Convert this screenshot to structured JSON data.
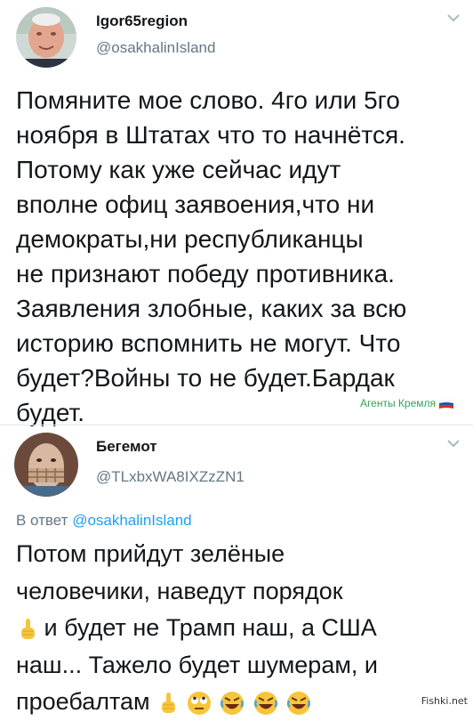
{
  "tweet1": {
    "name": "Igor65region",
    "handle": "@osakhalinIsland",
    "text": "Помяните мое слово. 4го или 5го\nноября в Штатах что то начнётся.\nПотому как уже сейчас идут\nвполне офиц заявоения,что ни\nдемократы,ни республиканцы\nне признают победу противника.\nЗаявления злобные, каких за всю\nисторию вспомнить не могут. Что\nбудет?Войны то не будет.Бардак\nбудет.",
    "badge": "Агенты Кремля"
  },
  "tweet2": {
    "name": "Бегемот",
    "handle": "@TLxbxWA8IXZzZN1",
    "reply_prefix": "В ответ",
    "reply_to": "@osakhalinIsland",
    "line1": "Потом прийдут зелёные",
    "line2": "человечики, наведут порядок",
    "line3": "и будет не Трамп наш, а США",
    "line4": "наш... Тажело будет шумерам, и",
    "line5": "проебалтам"
  },
  "watermark": "Fishki.net",
  "icons": [
    "chevron-down-icon",
    "russian-flag-icon",
    "pointing-finger-emoji",
    "rolling-eyes-emoji",
    "rofl-emoji"
  ],
  "colors": {
    "link": "#1da1f2",
    "secondary": "#657786",
    "badge": "#2aa65a"
  }
}
